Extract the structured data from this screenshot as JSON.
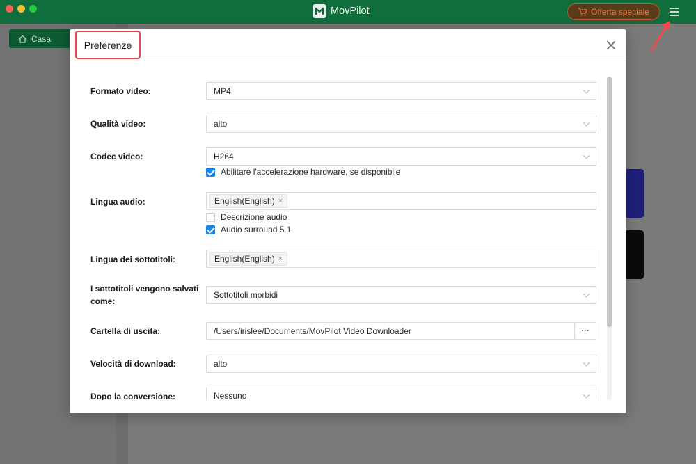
{
  "app": {
    "name": "MovPilot",
    "offer_label": "Offerta speciale",
    "home_tab": "Casa"
  },
  "dialog": {
    "title": "Preferenze",
    "rows": {
      "video_format": {
        "label": "Formato video:",
        "value": "MP4"
      },
      "video_quality": {
        "label": "Qualità video:",
        "value": "alto"
      },
      "video_codec": {
        "label": "Codec video:",
        "value": "H264",
        "hw_accel_label": "Abilitare l'accelerazione hardware, se disponibile",
        "hw_accel_checked": true
      },
      "audio_language": {
        "label": "Lingua audio:",
        "tag": "English(English)",
        "audio_desc_label": "Descrizione audio",
        "audio_desc_checked": false,
        "surround_label": "Audio surround 5.1",
        "surround_checked": true
      },
      "subtitle_language": {
        "label": "Lingua dei sottotitoli:",
        "tag": "English(English)"
      },
      "subtitle_save": {
        "label_line1": "I sottotitoli vengono salvati",
        "label_line2": "come:",
        "value": "Sottotitoli morbidi"
      },
      "output_folder": {
        "label": "Cartella di uscita:",
        "value": "/Users/irislee/Documents/MovPilot Video Downloader",
        "browse_label": "···"
      },
      "download_speed": {
        "label": "Velocità di download:",
        "value": "alto"
      },
      "after_conversion": {
        "label": "Dopo la conversione:",
        "value": "Nessuno"
      }
    }
  },
  "icons": {
    "close": "close-icon",
    "menu": "hamburger-menu-icon",
    "cart": "cart-icon",
    "home": "home-icon",
    "logo": "movpilot-logo-icon"
  },
  "colors": {
    "titlebar": "#0f6e3c",
    "accent_check": "#1a86e8",
    "highlight_box": "#e8484c",
    "offer_text": "#e07a3a"
  }
}
